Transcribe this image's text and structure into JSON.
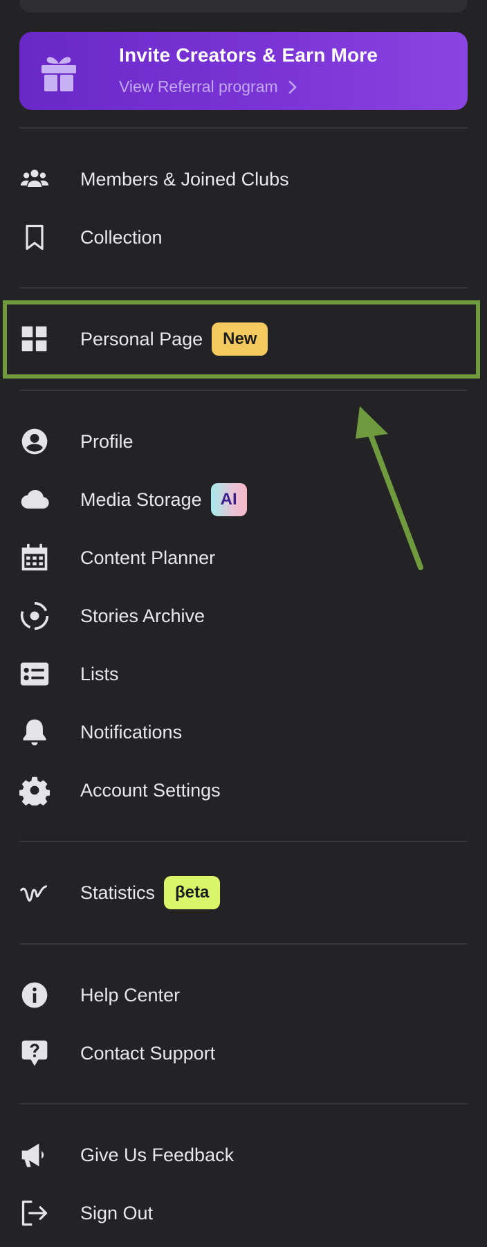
{
  "banner": {
    "title": "Invite Creators & Earn More",
    "link": "View Referral program",
    "gift_icon": "gift-icon",
    "accent": "#7030d0"
  },
  "menu": {
    "members": {
      "label": "Members & Joined Clubs",
      "icon": "users-icon"
    },
    "collection": {
      "label": "Collection",
      "icon": "bookmark-icon"
    },
    "personal_page": {
      "label": "Personal Page",
      "badge": "New",
      "icon": "grid-icon",
      "badge_color": "#f4c95e"
    },
    "profile": {
      "label": "Profile",
      "icon": "user-circle-icon"
    },
    "media_storage": {
      "label": "Media Storage",
      "badge": "AI",
      "icon": "cloud-icon"
    },
    "content_planner": {
      "label": "Content Planner",
      "icon": "calendar-icon"
    },
    "stories_archive": {
      "label": "Stories Archive",
      "icon": "stories-icon"
    },
    "lists": {
      "label": "Lists",
      "icon": "list-icon"
    },
    "notifications": {
      "label": "Notifications",
      "icon": "bell-icon"
    },
    "account_settings": {
      "label": "Account Settings",
      "icon": "gear-icon"
    },
    "statistics": {
      "label": "Statistics",
      "badge": "βeta",
      "icon": "stats-icon",
      "badge_color": "#d9f56a"
    },
    "help_center": {
      "label": "Help Center",
      "icon": "info-icon"
    },
    "contact_support": {
      "label": "Contact Support",
      "icon": "question-bubble-icon"
    },
    "feedback": {
      "label": "Give Us Feedback",
      "icon": "megaphone-icon"
    },
    "sign_out": {
      "label": "Sign Out",
      "icon": "sign-out-icon"
    }
  },
  "annotation": {
    "highlight_color": "#6f9a3e"
  }
}
